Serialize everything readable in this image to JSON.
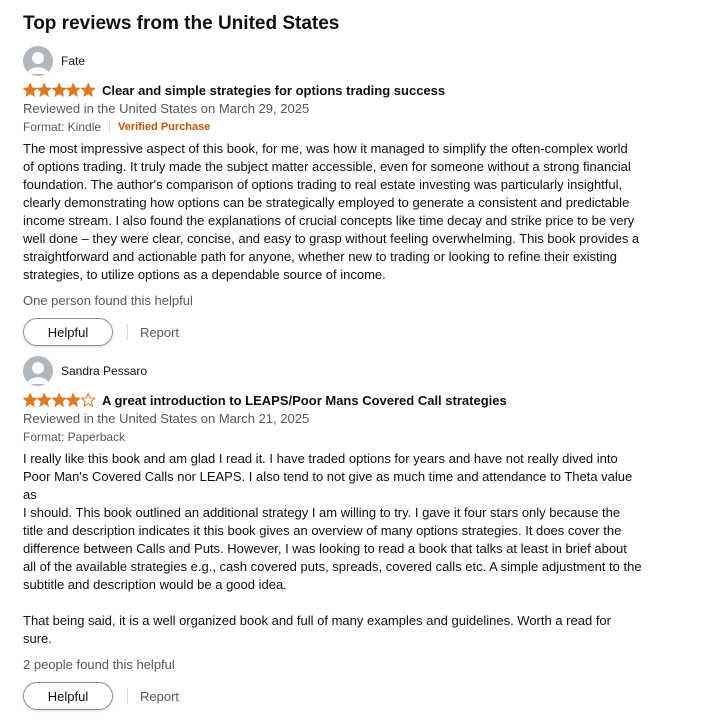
{
  "section_title": "Top reviews from the United States",
  "colors": {
    "star": "#de7921",
    "verified": "#c45500",
    "muted": "#565959"
  },
  "reviews": [
    {
      "name": "Fate",
      "rating": 5,
      "title": "Clear and simple strategies for options trading success",
      "reviewed": "Reviewed in the United States on March 29, 2025",
      "format": "Format: Kindle",
      "verified": "Verified Purchase",
      "body": "The most impressive aspect of this book, for me, was how it managed to simplify the often-complex world\nof options trading. It truly made the subject matter accessible, even for someone without a strong financial\nfoundation. The author's comparison of options trading to real estate investing was particularly insightful,\nclearly demonstrating how options can be strategically employed to generate a consistent and predictable\nincome stream. I also found the explanations of crucial concepts like time decay and strike price to be very\nwell done – they were clear, concise, and easy to grasp without feeling overwhelming. This book provides a\nstraightforward and actionable path for anyone, whether new to trading or looking to refine their existing\nstrategies, to utilize options as a dependable source of income.",
      "helpful_count": "One person found this helpful",
      "helpful_label": "Helpful",
      "report_label": "Report"
    },
    {
      "name": "Sandra Pessaro",
      "rating": 4,
      "title": "A great introduction to LEAPS/Poor Mans Covered Call strategies",
      "reviewed": "Reviewed in the United States on March 21, 2025",
      "format": "Format: Paperback",
      "verified": "",
      "body": "I really like this book and am glad I read it. I have traded options for years and have not really dived into\nPoor Man's Covered Calls nor LEAPS. I also tend to not give as much time and attendance to Theta value as\nI should. This book outlined an additional strategy I am willing to try. I gave it four stars only because the\ntitle and description indicates it this book gives an overview of many options strategies. It does cover the\ndifference between Calls and Puts. However, I was looking to read a book that talks at least in brief about\nall of the available strategies e.g., cash covered puts, spreads, covered calls etc. A simple adjustment to the\nsubtitle and description would be a good idea.\n\nThat being said, it is a well organized book and full of many examples and guidelines. Worth a read for\nsure.",
      "helpful_count": "2 people found this helpful",
      "helpful_label": "Helpful",
      "report_label": "Report"
    }
  ]
}
